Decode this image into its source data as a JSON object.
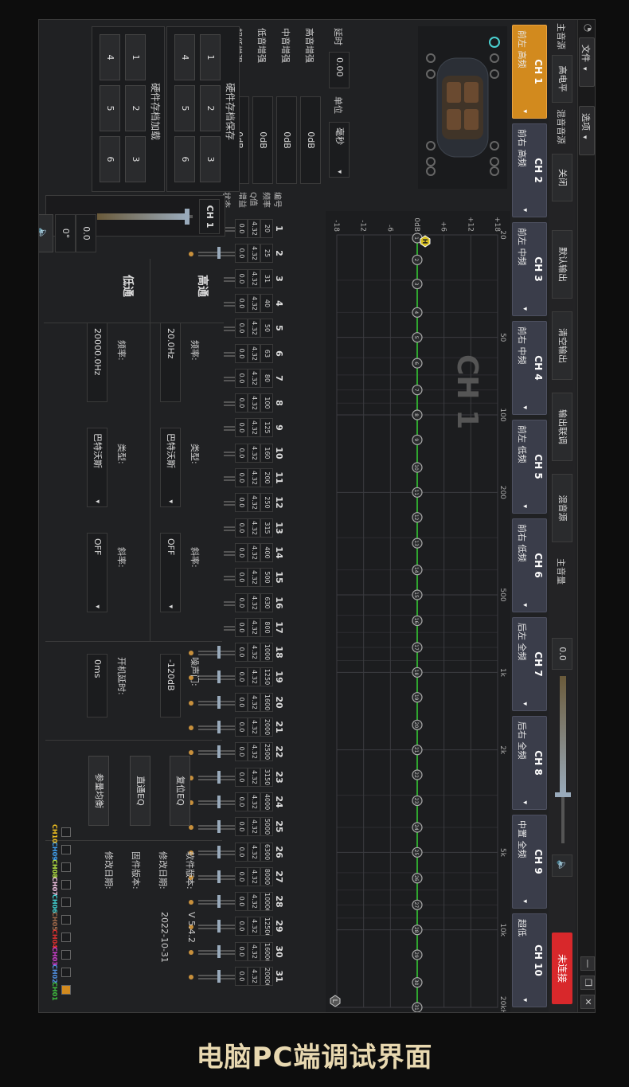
{
  "titlebar": {
    "menu_file": "文件",
    "menu_options": "选项",
    "btn_min": "—",
    "btn_max": "❐",
    "btn_close": "✕"
  },
  "toolbar": {
    "main_source_label": "主音源",
    "main_source_value": "高电平",
    "mix_source_label": "混音音源",
    "mix_source_value": "关闭",
    "btn_default_output": "默认输出",
    "btn_clear_output": "清空输出",
    "btn_output_link": "输出联调",
    "btn_mix_source": "混音源",
    "main_volume_label": "主音量",
    "main_volume_value": "0.0",
    "connect_label": "未连接"
  },
  "channels": [
    {
      "name": "CH 1",
      "desc": "前左 高频"
    },
    {
      "name": "CH 2",
      "desc": "前右 高频"
    },
    {
      "name": "CH 3",
      "desc": "前左 中频"
    },
    {
      "name": "CH 4",
      "desc": "前右 中频"
    },
    {
      "name": "CH 5",
      "desc": "前左 低频"
    },
    {
      "name": "CH 6",
      "desc": "前右 低频"
    },
    {
      "name": "CH 7",
      "desc": "后左 全频"
    },
    {
      "name": "CH 8",
      "desc": "后右 全频"
    },
    {
      "name": "CH 9",
      "desc": "中置 全频"
    },
    {
      "name": "CH 10",
      "desc": "超低"
    }
  ],
  "delay": {
    "label": "延时",
    "value": "0.00",
    "unit_label": "单位",
    "unit_value": "毫秒"
  },
  "enhance": [
    {
      "label": "高音增强",
      "value": "0dB"
    },
    {
      "label": "中音增强",
      "value": "0dB"
    },
    {
      "label": "低音增强",
      "value": "0dB"
    },
    {
      "label": "超低增强",
      "value": "0dB"
    }
  ],
  "preset_save": {
    "title": "硬件存档保存",
    "slots": [
      "1",
      "2",
      "3",
      "4",
      "5",
      "6"
    ]
  },
  "preset_load": {
    "title": "硬件存档加载",
    "slots": [
      "1",
      "2",
      "3",
      "4",
      "5",
      "6"
    ]
  },
  "channel_panel": {
    "name": "CH 1",
    "volume": "0.0",
    "phase": "0°"
  },
  "graph": {
    "channel_label": "CH 1",
    "db_ticks": [
      "+18",
      "+12",
      "+6",
      "0dB",
      "-6",
      "-12",
      "-18"
    ],
    "freq_ticks": [
      "20",
      "50",
      "100",
      "200",
      "500",
      "1k",
      "2k",
      "5k",
      "10k",
      "20kHz"
    ],
    "hp_marker": "H",
    "lp_marker": "L"
  },
  "eq_table": {
    "row_labels": {
      "band": "编号",
      "freq": "频率",
      "q": "Q值",
      "gain": "增益",
      "state": "状态"
    },
    "bands": [
      "1",
      "2",
      "3",
      "4",
      "5",
      "6",
      "7",
      "8",
      "9",
      "10",
      "11",
      "12",
      "13",
      "14",
      "15",
      "16",
      "17",
      "18",
      "19",
      "20",
      "21",
      "22",
      "23",
      "24",
      "25",
      "26",
      "27",
      "28",
      "29",
      "30",
      "31"
    ],
    "freqs": [
      "20",
      "25",
      "31",
      "40",
      "50",
      "63",
      "80",
      "100",
      "125",
      "160",
      "200",
      "250",
      "315",
      "400",
      "500",
      "630",
      "800",
      "1000",
      "1250",
      "1600",
      "2000",
      "2500",
      "3150",
      "4000",
      "5000",
      "6300",
      "8000",
      "10000",
      "12500",
      "16000",
      "20000"
    ],
    "q": "4.32",
    "gain": "0.0"
  },
  "highpass": {
    "title": "高通",
    "freq_label": "频率:",
    "freq_value": "20.0Hz",
    "type_label": "类型:",
    "type_value": "巴特沃斯",
    "slope_label": "斜率:",
    "slope_value": "OFF"
  },
  "lowpass": {
    "title": "低通",
    "freq_label": "频率:",
    "freq_value": "20000.0Hz",
    "type_label": "类型:",
    "type_value": "巴特沃斯",
    "slope_label": "斜率:",
    "slope_value": "OFF"
  },
  "noise_gate": {
    "label": "噪声门:",
    "value": "-120dB"
  },
  "startup_delay": {
    "label": "开机延时:",
    "value": "0ms"
  },
  "eq_buttons": {
    "reset": "复位EQ",
    "bypass": "直通EQ",
    "parametric": "参量均衡"
  },
  "info": {
    "software_version_label": "软件版本:",
    "software_version": "V 5.4.2",
    "modify_date_label": "修改日期:",
    "modify_date": "2022-10-31",
    "firmware_version_label": "固件版本:",
    "firmware_version": "",
    "firmware_date_label": "修改日期:",
    "firmware_date": ""
  },
  "legend": [
    {
      "name": "CH01",
      "color": "#3fbf3f"
    },
    {
      "name": "CH02",
      "color": "#4f8fe0"
    },
    {
      "name": "CH03",
      "color": "#d040d0"
    },
    {
      "name": "CH04",
      "color": "#e03030"
    },
    {
      "name": "CH05",
      "color": "#a06a4a"
    },
    {
      "name": "CH06",
      "color": "#40d0d0"
    },
    {
      "name": "CH07",
      "color": "#f0c0e0"
    },
    {
      "name": "CH08",
      "color": "#b0e040"
    },
    {
      "name": "CH09",
      "color": "#40a0f0"
    },
    {
      "name": "CH10",
      "color": "#f0c020"
    }
  ],
  "caption": "电脑PC端调试界面"
}
